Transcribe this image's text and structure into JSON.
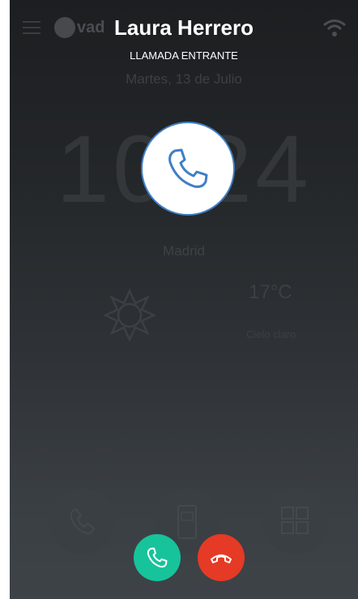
{
  "colors": {
    "accept": "#17c39a",
    "reject": "#e53a25",
    "avatar_ring": "#3f7fc6"
  },
  "background": {
    "logo_text": "vad",
    "date": "Martes, 13 de Julio",
    "time": "10:24",
    "city": "Madrid",
    "temperature": "17°C",
    "condition": "Cielo claro",
    "icons": [
      "menu-icon",
      "wifi-icon",
      "sun-icon",
      "phone-icon",
      "intercom-icon",
      "grid-icon"
    ]
  },
  "call": {
    "caller_name": "Laura Herrero",
    "status": "LLAMADA ENTRANTE",
    "avatar_icon": "phone-icon",
    "accept_icon": "phone-icon",
    "reject_icon": "hangup-icon"
  }
}
